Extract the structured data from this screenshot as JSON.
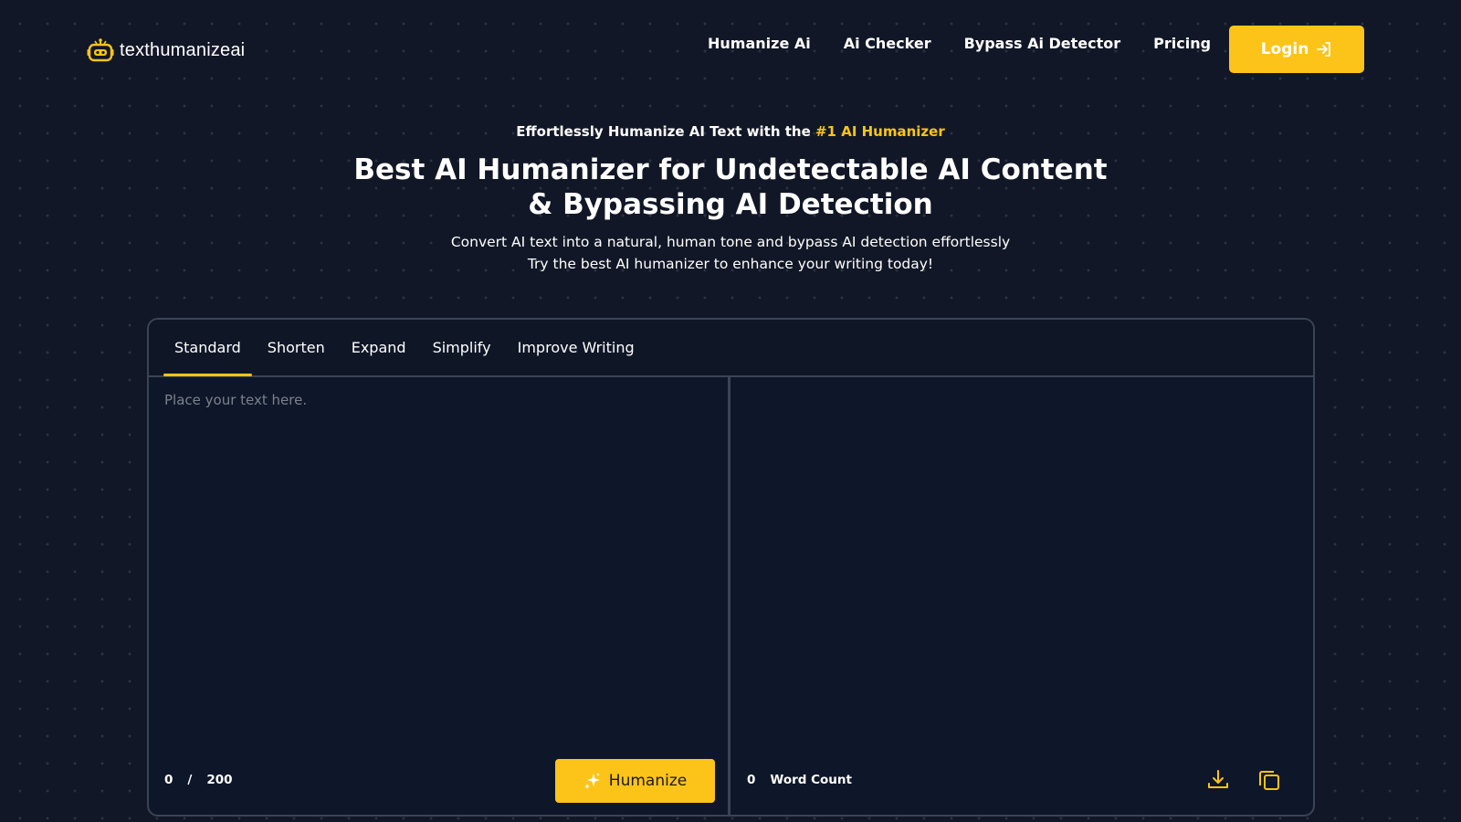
{
  "brand": {
    "name": "texthumanizeai",
    "accent_color": "#fcc419",
    "icon": "robot-icon"
  },
  "nav": {
    "links": [
      "Humanize Ai",
      "Ai Checker",
      "Bypass Ai Detector",
      "Pricing"
    ],
    "login_label": "Login",
    "login_icon": "login-arrow-icon"
  },
  "hero": {
    "eyebrow_prefix": "Effortlessly Humanize AI Text with the ",
    "eyebrow_highlight": "#1 AI Humanizer",
    "title": "Best AI Humanizer for Undetectable AI Content & Bypassing AI Detection",
    "subtitle_line1": "Convert AI text into a natural, human tone and bypass AI detection effortlessly",
    "subtitle_line2": "Try the best AI humanizer to enhance your writing today!"
  },
  "tool": {
    "tabs": [
      "Standard",
      "Shorten",
      "Expand",
      "Simplify",
      "Improve Writing"
    ],
    "active_tab": "Standard",
    "input": {
      "placeholder": "Place your text here.",
      "value": ""
    },
    "counter": {
      "current": "0",
      "separator": "/",
      "max": "200"
    },
    "humanize_label": "Humanize",
    "humanize_icon": "sparkle-icon",
    "output": {
      "word_count_value": "0",
      "word_count_label": "Word Count",
      "download_icon": "download-icon",
      "copy_icon": "copy-icon"
    }
  }
}
